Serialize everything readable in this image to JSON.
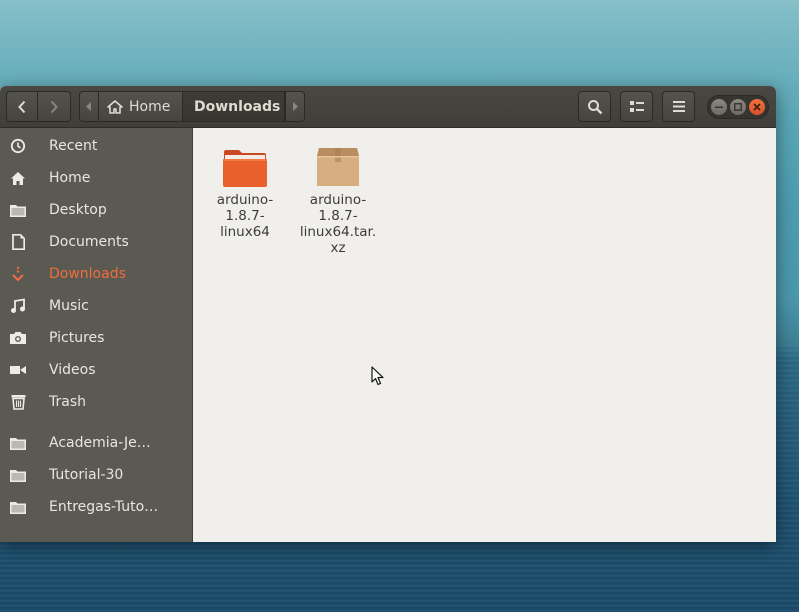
{
  "header": {
    "path": [
      {
        "label": "Home",
        "icon": "home-icon"
      },
      {
        "label": "Downloads",
        "active": true
      }
    ]
  },
  "sidebar": {
    "items": [
      {
        "label": "Recent",
        "icon": "clock-icon"
      },
      {
        "label": "Home",
        "icon": "home-icon"
      },
      {
        "label": "Desktop",
        "icon": "folder-icon"
      },
      {
        "label": "Documents",
        "icon": "document-icon"
      },
      {
        "label": "Downloads",
        "icon": "download-icon",
        "active": true
      },
      {
        "label": "Music",
        "icon": "music-icon"
      },
      {
        "label": "Pictures",
        "icon": "camera-icon"
      },
      {
        "label": "Videos",
        "icon": "video-icon"
      },
      {
        "label": "Trash",
        "icon": "trash-icon"
      },
      {
        "label": "Academia-Je…",
        "icon": "folder-icon"
      },
      {
        "label": "Tutorial-30",
        "icon": "folder-icon"
      },
      {
        "label": "Entregas-Tuto…",
        "icon": "folder-icon"
      }
    ]
  },
  "files": [
    {
      "name": "arduino-1.8.7-linux64",
      "lines": [
        "arduino-",
        "1.8.7-",
        "linux64"
      ],
      "icon": "orange-folder-icon"
    },
    {
      "name": "arduino-1.8.7-linux64.tar.xz",
      "lines": [
        "arduino-",
        "1.8.7-",
        "linux64.tar.",
        "xz"
      ],
      "icon": "archive-icon"
    }
  ],
  "colors": {
    "accent": "#ef6d3e",
    "sidebar_bg": "#5b5a52",
    "headerbar_bg": "#45433e",
    "content_bg": "#f0efeb"
  }
}
